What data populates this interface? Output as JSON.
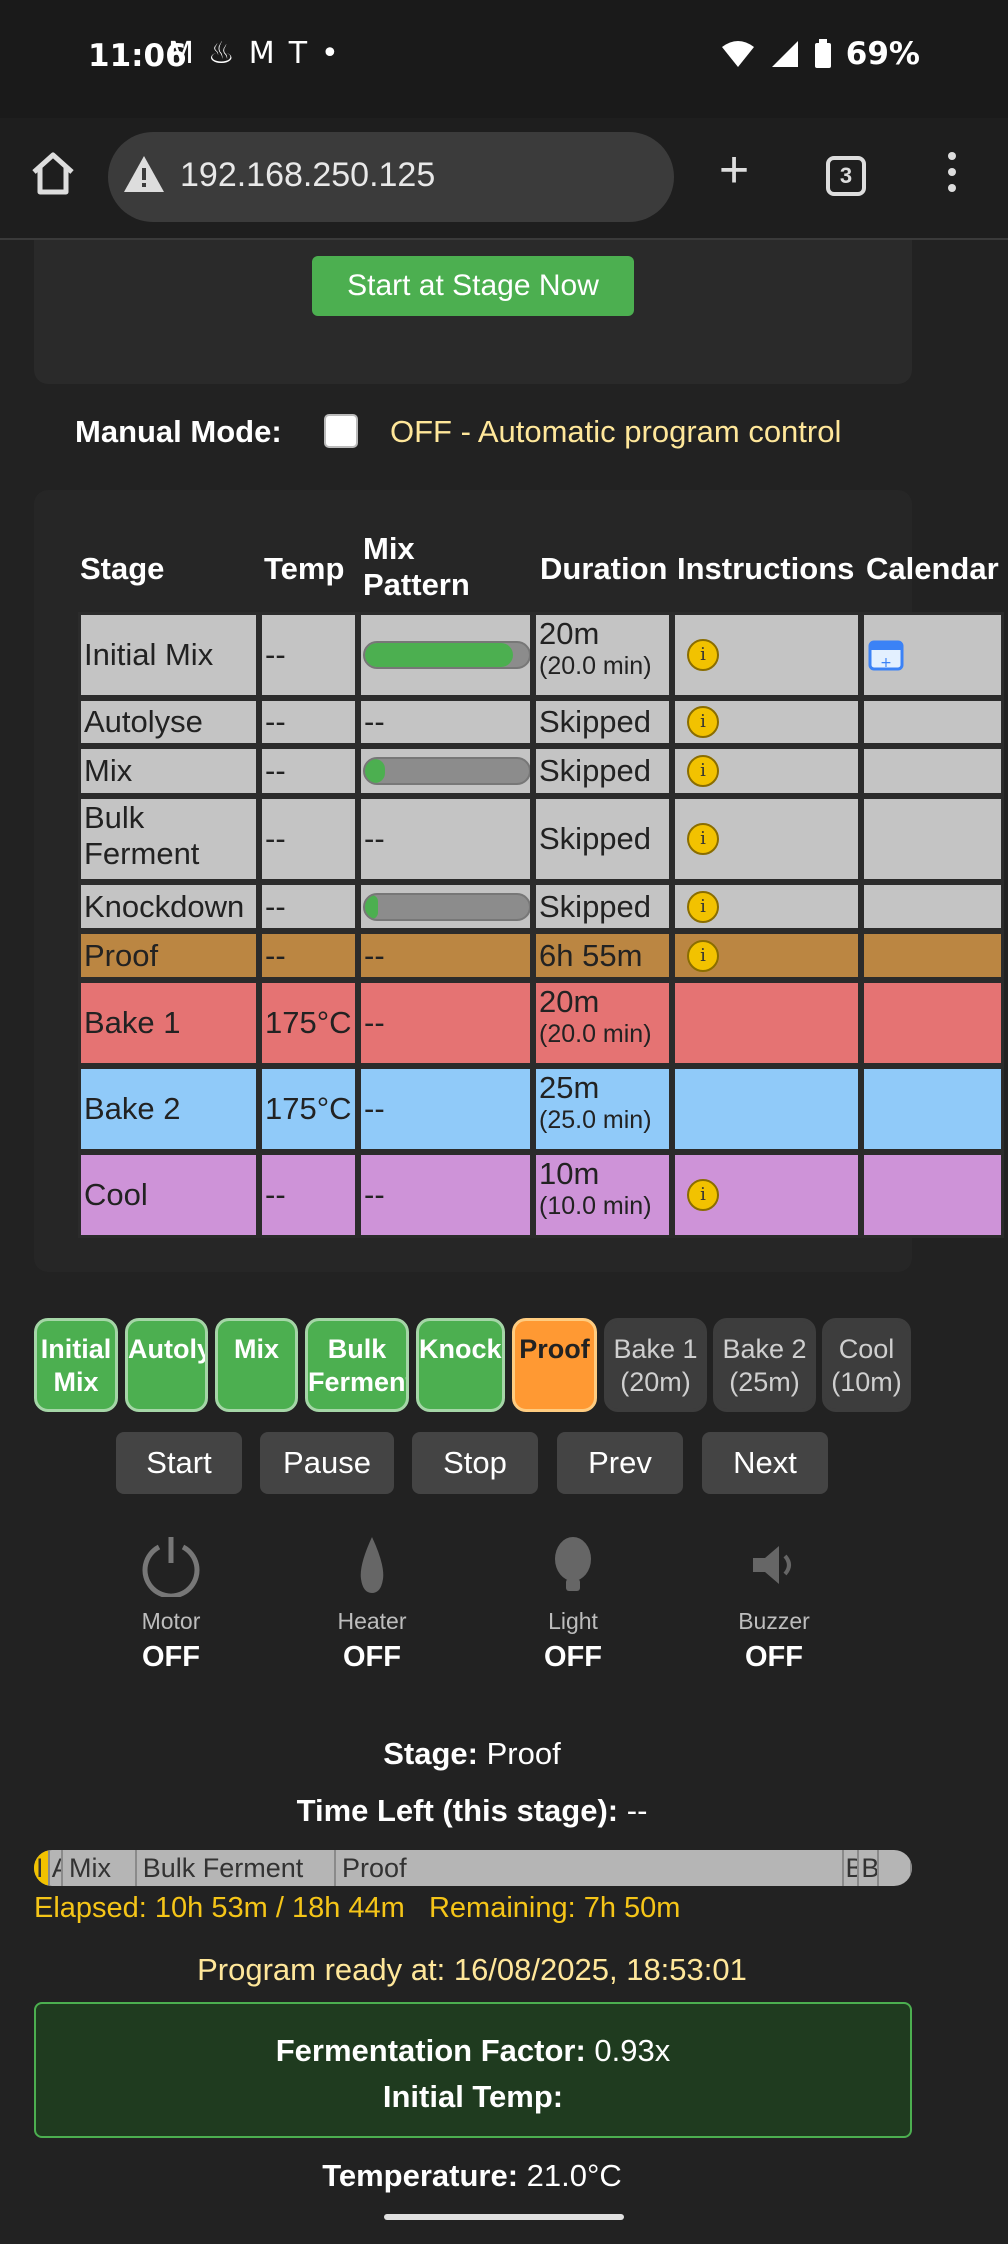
{
  "status_bar": {
    "time": "11:06",
    "notification_icons": [
      "gmail-icon",
      "fire-icon",
      "gmail-icon",
      "tesla-icon",
      "dot-icon"
    ],
    "battery": "69%"
  },
  "browser": {
    "url": "192.168.250.125",
    "tab_count": "3"
  },
  "top_card": {
    "start_button": "Start at Stage Now"
  },
  "manual_mode": {
    "label": "Manual Mode:",
    "checked": false,
    "status": "OFF - Automatic program control"
  },
  "stage_table": {
    "headers": {
      "stage": "Stage",
      "temp": "Temp",
      "mix_pattern_1": "Mix",
      "mix_pattern_2": "Pattern",
      "duration": "Duration",
      "instructions": "Instructions",
      "calendar": "Calendar"
    },
    "rows": [
      {
        "stage": "Initial Mix",
        "temp": "--",
        "mix": "",
        "mix_fill": 0.9,
        "duration": "20m",
        "duration_sub": "(20.0 min)",
        "info": true,
        "calendar": true,
        "color": "#c4c4c4"
      },
      {
        "stage": "Autolyse",
        "temp": "--",
        "mix": "--",
        "duration": "Skipped",
        "duration_sub": "",
        "info": true,
        "calendar": false,
        "color": "#c4c4c4"
      },
      {
        "stage": "Mix",
        "temp": "--",
        "mix": "",
        "mix_fill": 0.12,
        "duration": "Skipped",
        "duration_sub": "",
        "info": true,
        "calendar": false,
        "color": "#c4c4c4"
      },
      {
        "stage": "Bulk",
        "stage_2": "Ferment",
        "temp": "--",
        "mix": "--",
        "duration": "Skipped",
        "duration_sub": "",
        "info": true,
        "calendar": false,
        "color": "#c4c4c4"
      },
      {
        "stage": "Knockdown",
        "temp": "--",
        "mix": "",
        "mix_fill": 0.08,
        "duration": "Skipped",
        "duration_sub": "",
        "info": true,
        "calendar": false,
        "color": "#c4c4c4"
      },
      {
        "stage": "Proof",
        "temp": "--",
        "mix": "--",
        "duration": "6h 55m",
        "duration_sub": "",
        "info": true,
        "calendar": false,
        "color": "#bb8642"
      },
      {
        "stage": "Bake 1",
        "temp": "175°C",
        "mix": "--",
        "duration": "20m",
        "duration_sub": "(20.0 min)",
        "info": false,
        "calendar": false,
        "color": "#e57373"
      },
      {
        "stage": "Bake 2",
        "temp": "175°C",
        "mix": "--",
        "duration": "25m",
        "duration_sub": "(25.0 min)",
        "info": false,
        "calendar": false,
        "color": "#90caf9"
      },
      {
        "stage": "Cool",
        "temp": "--",
        "mix": "--",
        "duration": "10m",
        "duration_sub": "(10.0 min)",
        "info": true,
        "calendar": false,
        "color": "#ce93d8"
      }
    ],
    "info_glyph": "i"
  },
  "stage_pills": [
    {
      "line1": "Initial",
      "line2": "Mix",
      "state": "done"
    },
    {
      "line1": "Autolyse",
      "line2": "",
      "state": "done"
    },
    {
      "line1": "Mix",
      "line2": "",
      "state": "done"
    },
    {
      "line1": "Bulk",
      "line2": "Ferment",
      "state": "done"
    },
    {
      "line1": "Knockdown",
      "line2": "",
      "state": "done"
    },
    {
      "line1": "Proof",
      "line2": "",
      "state": "active"
    },
    {
      "line1": "Bake 1",
      "line2": "(20m)",
      "state": "pending"
    },
    {
      "line1": "Bake 2",
      "line2": "(25m)",
      "state": "pending"
    },
    {
      "line1": "Cool",
      "line2": "(10m)",
      "state": "pending"
    }
  ],
  "controls": {
    "start": "Start",
    "pause": "Pause",
    "stop": "Stop",
    "prev": "Prev",
    "next": "Next"
  },
  "devices": [
    {
      "name": "Motor",
      "state": "OFF",
      "icon": "power-icon"
    },
    {
      "name": "Heater",
      "state": "OFF",
      "icon": "flame-icon"
    },
    {
      "name": "Light",
      "state": "OFF",
      "icon": "bulb-icon"
    },
    {
      "name": "Buzzer",
      "state": "OFF",
      "icon": "speaker-icon"
    }
  ],
  "status": {
    "stage_label": "Stage:",
    "stage_value": "Proof",
    "time_left_label": "Time Left (this stage):",
    "time_left_value": "--"
  },
  "timeline": {
    "segments": [
      {
        "label": "I",
        "fraction": 0.018
      },
      {
        "label": "A",
        "fraction": 0.015
      },
      {
        "label": "Mix",
        "fraction": 0.084
      },
      {
        "label": "Bulk Ferment",
        "fraction": 0.227
      },
      {
        "label": "Proof",
        "fraction": 0.578
      },
      {
        "label": "B",
        "fraction": 0.018
      },
      {
        "label": "B",
        "fraction": 0.022
      },
      {
        "label": "",
        "fraction": 0.038
      }
    ],
    "elapsed": "Elapsed: 10h 53m / 18h 44m",
    "remaining": "Remaining: 7h 50m"
  },
  "ready_text": "Program ready at: 16/08/2025, 18:53:01",
  "fermentation": {
    "factor_label": "Fermentation Factor:",
    "factor_value": "0.93x",
    "initial_temp_label": "Initial Temp:"
  },
  "temperature": {
    "label": "Temperature:",
    "value": "21.0°C"
  }
}
